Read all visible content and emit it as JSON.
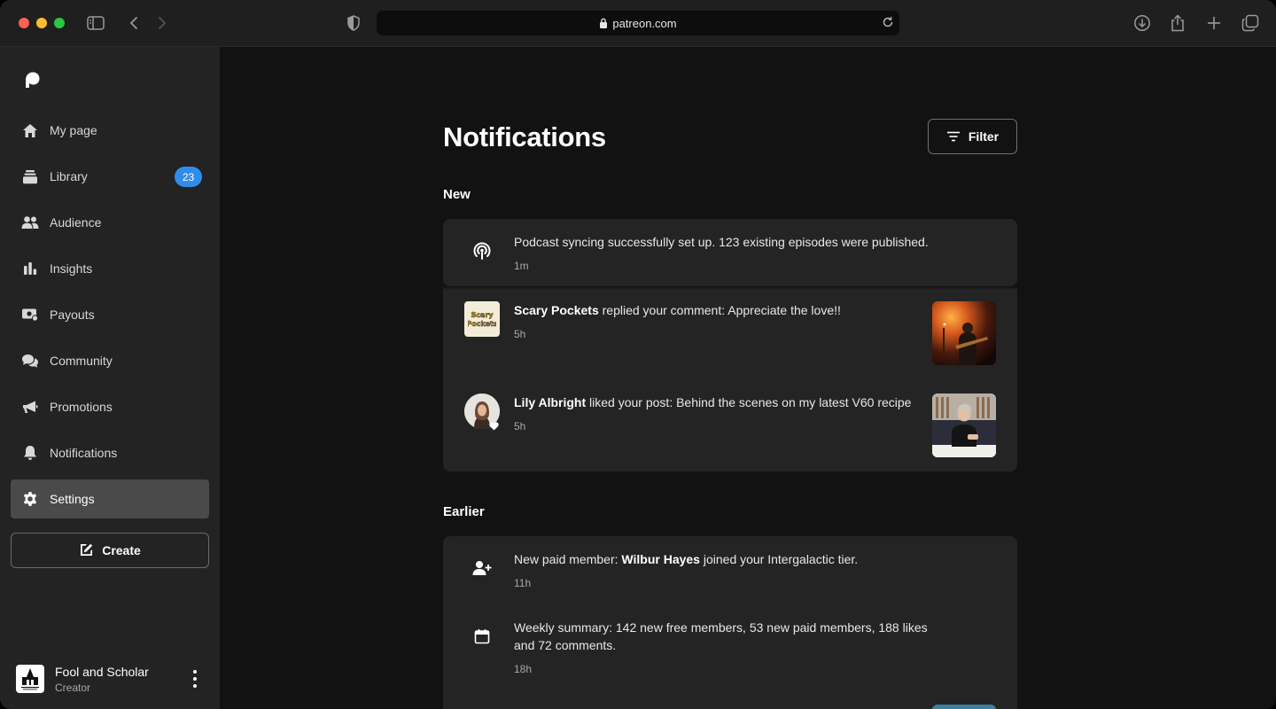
{
  "browser": {
    "url": "patreon.com"
  },
  "sidebar": {
    "items": [
      {
        "label": "My page",
        "icon": "home-icon"
      },
      {
        "label": "Library",
        "icon": "library-icon",
        "badge": "23"
      },
      {
        "label": "Audience",
        "icon": "audience-icon"
      },
      {
        "label": "Insights",
        "icon": "insights-icon"
      },
      {
        "label": "Payouts",
        "icon": "payouts-icon"
      },
      {
        "label": "Community",
        "icon": "community-icon"
      },
      {
        "label": "Promotions",
        "icon": "megaphone-icon"
      },
      {
        "label": "Notifications",
        "icon": "bell-icon"
      },
      {
        "label": "Settings",
        "icon": "gear-icon",
        "active": true
      }
    ],
    "create_label": "Create",
    "profile": {
      "name": "Fool and Scholar",
      "role": "Creator"
    }
  },
  "main": {
    "title": "Notifications",
    "filter_label": "Filter",
    "sections": {
      "new_label": "New",
      "earlier_label": "Earlier"
    },
    "new": [
      {
        "icon": "podcast-icon",
        "text": "Podcast syncing successfully set up. 123 existing episodes were published.",
        "time": "1m"
      },
      {
        "actor": "Scary Pockets",
        "text": " replied your comment: Appreciate the love!!",
        "time": "5h",
        "avatar_text": "Scary Pockets"
      },
      {
        "actor": "Lily Albright",
        "text": " liked your post: Behind the scenes on my latest V60 recipe",
        "time": "5h"
      }
    ],
    "earlier": [
      {
        "icon": "add-user-icon",
        "prefix": "New paid member: ",
        "actor": "Wilbur Hayes",
        "suffix": " joined your Intergalactic tier.",
        "time": "11h"
      },
      {
        "icon": "calendar-icon",
        "text": "Weekly summary: 142 new free members, 53 new paid members, 188 likes and 72 comments.",
        "time": "18h"
      }
    ]
  },
  "colors": {
    "badge": "#2f8dea",
    "sidebar_bg": "#232323",
    "main_bg": "#121212",
    "card_bg": "#242424"
  }
}
